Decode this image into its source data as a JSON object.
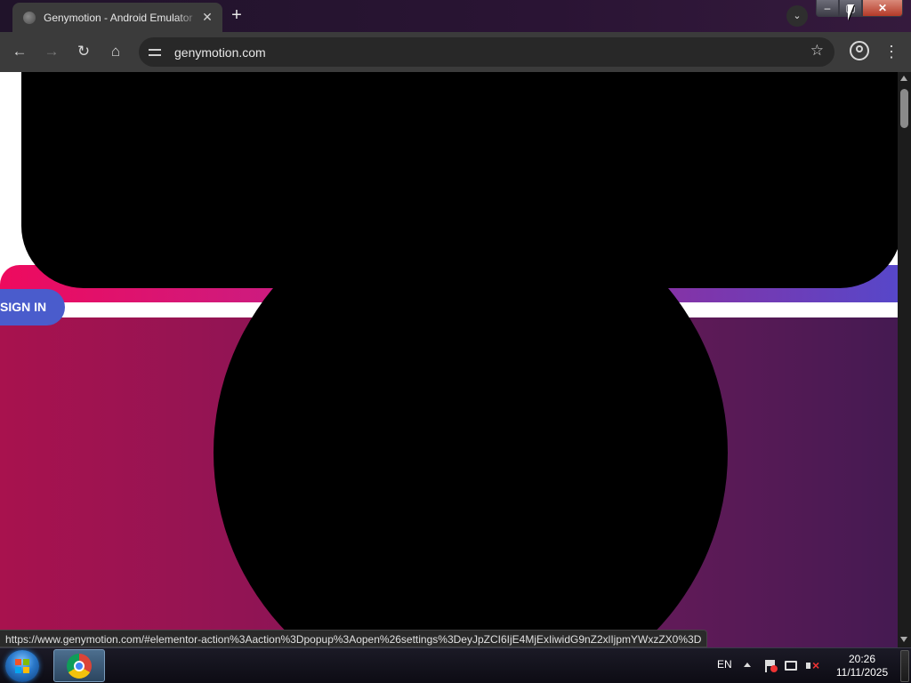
{
  "browser": {
    "tab": {
      "title": "Genymotion - Android Emulator",
      "close_glyph": "✕"
    },
    "new_tab_glyph": "+",
    "tab_search_glyph": "⌄",
    "window_controls": {
      "minimize_glyph": "–",
      "maximize_glyph": "▢",
      "close_glyph": "✕"
    },
    "nav": {
      "back_glyph": "←",
      "forward_glyph": "→",
      "reload_glyph": "↻",
      "home_glyph": "⌂"
    },
    "address_bar": {
      "url": "genymotion.com"
    },
    "bookmark_glyph": "☆",
    "menu_glyph": "⋮",
    "status_link": "https://www.genymotion.com/#elementor-action%3Aaction%3Dpopup%3Aopen%26settings%3DeyJpZCI6IjE4MjExIiwidG9nZ2xlIjpmYWxzZX0%3D"
  },
  "page": {
    "sign_in_label": "SIGN IN",
    "colors": {
      "gradient_start": "#ee0a5e",
      "gradient_end": "#5747c9",
      "sign_in_bg": "#4a5ccc",
      "section_left": "#a8124e",
      "section_right": "#451a52"
    }
  },
  "taskbar": {
    "language": "EN",
    "time": "20:26",
    "date": "11/11/2025"
  }
}
